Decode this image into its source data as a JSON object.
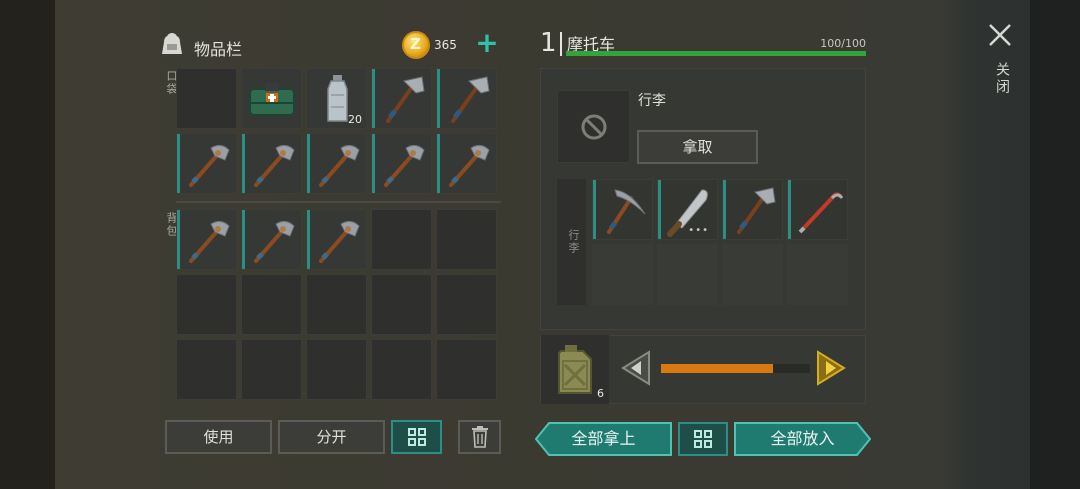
{
  "inventory": {
    "title": "物品栏",
    "coin_symbol": "Z",
    "coins": "365",
    "add_coins": "+",
    "pocket_label": "口袋",
    "backpack_label": "背包",
    "pocket_slots": [
      {
        "item": "empty"
      },
      {
        "item": "first-aid-kit"
      },
      {
        "item": "water-bottle",
        "count": "20"
      },
      {
        "item": "hatchet"
      },
      {
        "item": "hatchet"
      },
      {
        "item": "stone-axe"
      },
      {
        "item": "stone-axe"
      },
      {
        "item": "stone-axe"
      },
      {
        "item": "stone-axe"
      },
      {
        "item": "stone-axe"
      }
    ],
    "backpack_slots": [
      {
        "item": "stone-axe"
      },
      {
        "item": "stone-axe"
      },
      {
        "item": "stone-axe"
      },
      {
        "item": "empty"
      },
      {
        "item": "empty"
      },
      {
        "item": "empty"
      },
      {
        "item": "empty"
      },
      {
        "item": "empty"
      },
      {
        "item": "empty"
      },
      {
        "item": "empty"
      },
      {
        "item": "empty"
      },
      {
        "item": "empty"
      },
      {
        "item": "empty"
      },
      {
        "item": "empty"
      },
      {
        "item": "empty"
      }
    ],
    "use_label": "使用",
    "split_label": "分开",
    "sort_icon": "grid-sort-icon",
    "trash_icon": "trash-icon"
  },
  "vehicle": {
    "level": "1",
    "name": "摩托车",
    "hp_text": "100/100",
    "hp_fraction": 1.0,
    "luggage_title": "行李",
    "take_label": "拿取",
    "cargo_label": "行李",
    "cargo_slots": [
      {
        "item": "pickaxe"
      },
      {
        "item": "machete",
        "dots": "•••"
      },
      {
        "item": "hatchet"
      },
      {
        "item": "crowbar"
      },
      {
        "item": "empty"
      },
      {
        "item": "empty"
      },
      {
        "item": "empty"
      },
      {
        "item": "empty"
      }
    ],
    "fuel_count": "6",
    "fuel_level": 0.75,
    "take_all_label": "全部拿上",
    "put_all_label": "全部放入"
  },
  "close": {
    "label": "关闭"
  },
  "colors": {
    "accent_teal": "#2b8f84",
    "hp_green": "#34a33c",
    "fuel_orange": "#d97a10",
    "arrow_yellow": "#c9a21c"
  }
}
